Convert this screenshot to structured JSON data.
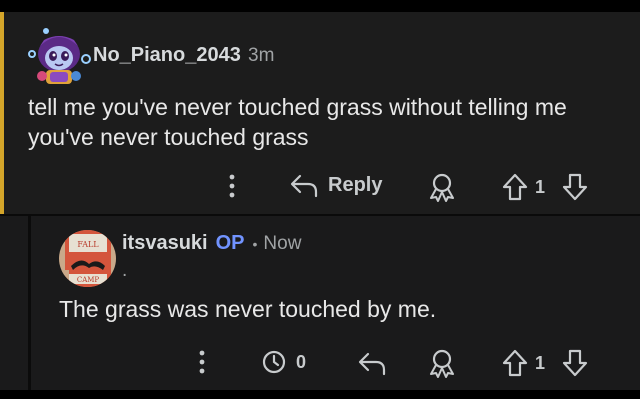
{
  "parent_comment": {
    "username": "No_Piano_2043",
    "time": "3m",
    "body_line1": "tell me you've never touched grass without telling me",
    "body_line2": "you've never touched grass",
    "reply_label": "Reply",
    "vote_count": "1",
    "accent_color": "#d4a52a"
  },
  "reply_comment": {
    "username": "itsvasuki",
    "op_badge": "OP",
    "separator": "•",
    "time": "Now",
    "dot": ".",
    "body": "The grass was never touched by me.",
    "reply_count": "0",
    "vote_count": "1",
    "op_color": "#7193ff",
    "avatar_text_top": "FALL",
    "avatar_text_bottom": "CAMP"
  },
  "icons": {
    "more": "more-vertical-icon",
    "reply": "reply-arrow-icon",
    "award": "award-icon",
    "upvote": "upvote-arrow-icon",
    "downvote": "downvote-arrow-icon",
    "replies": "reply-count-icon"
  }
}
